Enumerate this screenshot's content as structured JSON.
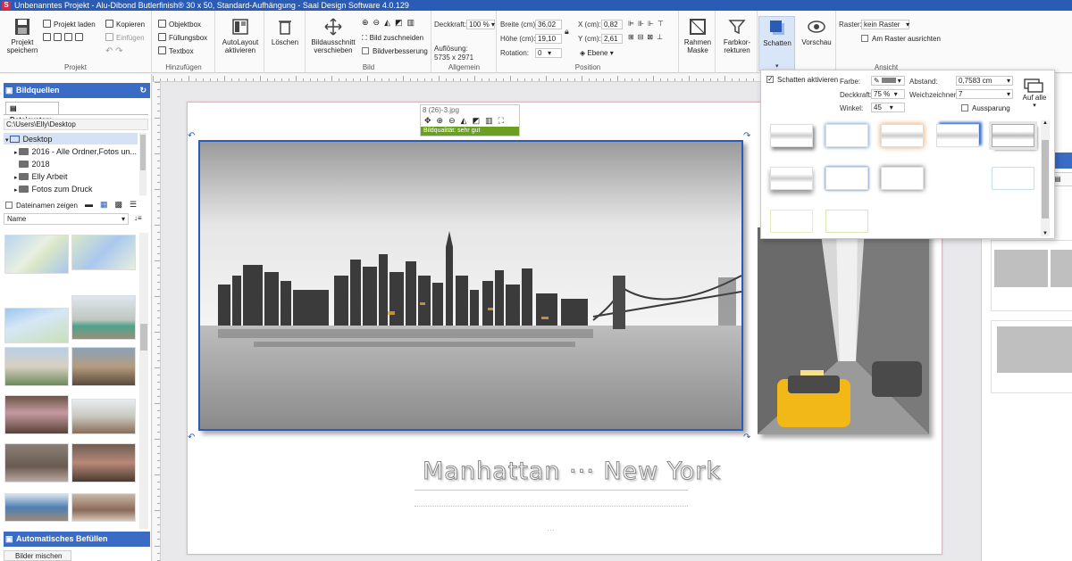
{
  "window": {
    "title": "Unbenanntes Projekt - Alu-Dibond Butlerfinish® 30 x 50, Standard-Aufhängung - Saal Design Software 4.0.129",
    "app_logo": "S"
  },
  "ribbon": {
    "projekt": {
      "label": "Projekt",
      "save": "Projekt speichern",
      "load": "Projekt laden",
      "copy": "Kopieren",
      "paste": "Einfügen"
    },
    "hinzufuegen": {
      "label": "Hinzufügen",
      "objektbox": "Objektbox",
      "fuellungsbox": "Füllungsbox",
      "textbox": "Textbox"
    },
    "autolayout": "AutoLayout aktivieren",
    "loeschen": "Löschen",
    "bild": {
      "label": "Bild",
      "crop_move": "Bildausschnitt verschieben",
      "crop": "Bild zuschneiden",
      "enhance": "Bildverbesserung"
    },
    "allgemein": {
      "label": "Allgemein",
      "opacity_label": "Deckkraft:",
      "opacity_value": "100 %",
      "resolution_label": "Auflösung:",
      "resolution_value": "5735 x 2971"
    },
    "position": {
      "label": "Position",
      "width_label": "Breite (cm):",
      "width_value": "36,02",
      "height_label": "Höhe (cm):",
      "height_value": "19,10",
      "rotation_label": "Rotation:",
      "rotation_value": "0",
      "x_label": "X (cm):",
      "x_value": "0,82",
      "y_label": "Y (cm):",
      "y_value": "2,61",
      "layer": "Ebene"
    },
    "rahmen": "Rahmen Maske",
    "farbkorrektur": "Farbkor- rekturen",
    "schatten": "Schatten",
    "vorschau": "Vorschau",
    "ansicht": {
      "label": "Ansicht",
      "grid_label": "Raster:",
      "grid_value": "kein Raster",
      "snap": "Am Raster ausrichten"
    }
  },
  "left_panel": {
    "title": "Bildquellen",
    "tab": "Dateisystem",
    "path": "C:\\Users\\Elly\\Desktop",
    "tree": [
      "Desktop",
      "2016 - Alle Ordner,Fotos un...",
      "2018",
      "Elly Arbeit",
      "Fotos zum Druck"
    ],
    "show_names": "Dateinamen zeigen",
    "sort": "Name",
    "bottom_title": "Automatisches Befüllen",
    "bottom_button": "Bilder mischen"
  },
  "canvas": {
    "filename": "8 (26)-3.jpg",
    "quality": "Bildqualität: sehr gut",
    "caption": "Manhattan ··· New York",
    "dots": "···"
  },
  "shadow_panel": {
    "enable": "Schatten aktivieren",
    "color_label": "Farbe:",
    "opacity_label": "Deckkraft:",
    "opacity_value": "75 %",
    "angle_label": "Winkel:",
    "angle_value": "45",
    "distance_label": "Abstand:",
    "distance_value": "0,7583 cm",
    "blur_label": "Weichzeichnen:",
    "blur_value": "7",
    "cutout": "Aussparung",
    "apply_all": "Auf alle"
  },
  "colors": {
    "accent": "#3a6bc5",
    "title_bar": "#2a5bb5",
    "quality_green": "#6aa01f"
  }
}
